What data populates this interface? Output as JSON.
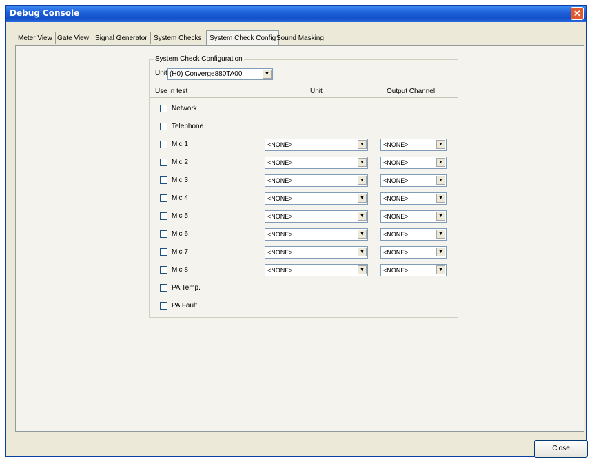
{
  "window": {
    "title": "Debug Console",
    "close_glyph": "✕"
  },
  "tabs": [
    {
      "label": "Meter View"
    },
    {
      "label": "Gate View"
    },
    {
      "label": "Signal Generator"
    },
    {
      "label": "System Checks"
    },
    {
      "label": "System Check Config",
      "active": true
    },
    {
      "label": "Sound Masking"
    }
  ],
  "config": {
    "group_title": "System Check Configuration",
    "unit_label": "Unit",
    "unit_value": "(H0) Converge880TA00",
    "headers": {
      "use_in_test": "Use in test",
      "unit": "Unit",
      "output_channel": "Output Channel"
    },
    "rows": [
      {
        "label": "Network",
        "checked": false
      },
      {
        "label": "Telephone",
        "checked": false
      },
      {
        "label": "Mic 1",
        "checked": false,
        "unit": "<NONE>",
        "channel": "<NONE>"
      },
      {
        "label": "Mic 2",
        "checked": false,
        "unit": "<NONE>",
        "channel": "<NONE>"
      },
      {
        "label": "Mic 3",
        "checked": false,
        "unit": "<NONE>",
        "channel": "<NONE>"
      },
      {
        "label": "Mic 4",
        "checked": false,
        "unit": "<NONE>",
        "channel": "<NONE>"
      },
      {
        "label": "Mic 5",
        "checked": false,
        "unit": "<NONE>",
        "channel": "<NONE>"
      },
      {
        "label": "Mic 6",
        "checked": false,
        "unit": "<NONE>",
        "channel": "<NONE>"
      },
      {
        "label": "Mic 7",
        "checked": false,
        "unit": "<NONE>",
        "channel": "<NONE>"
      },
      {
        "label": "Mic 8",
        "checked": false,
        "unit": "<NONE>",
        "channel": "<NONE>"
      },
      {
        "label": "PA Temp.",
        "checked": false
      },
      {
        "label": "PA Fault",
        "checked": false
      }
    ]
  },
  "footer": {
    "close_label": "Close"
  },
  "icons": {
    "dropdown": "chevron-down-icon",
    "window_close": "close-icon"
  },
  "colors": {
    "titlebar": "#1c5fd8",
    "window_bg": "#ece9d8",
    "close_button": "#e0592f"
  }
}
